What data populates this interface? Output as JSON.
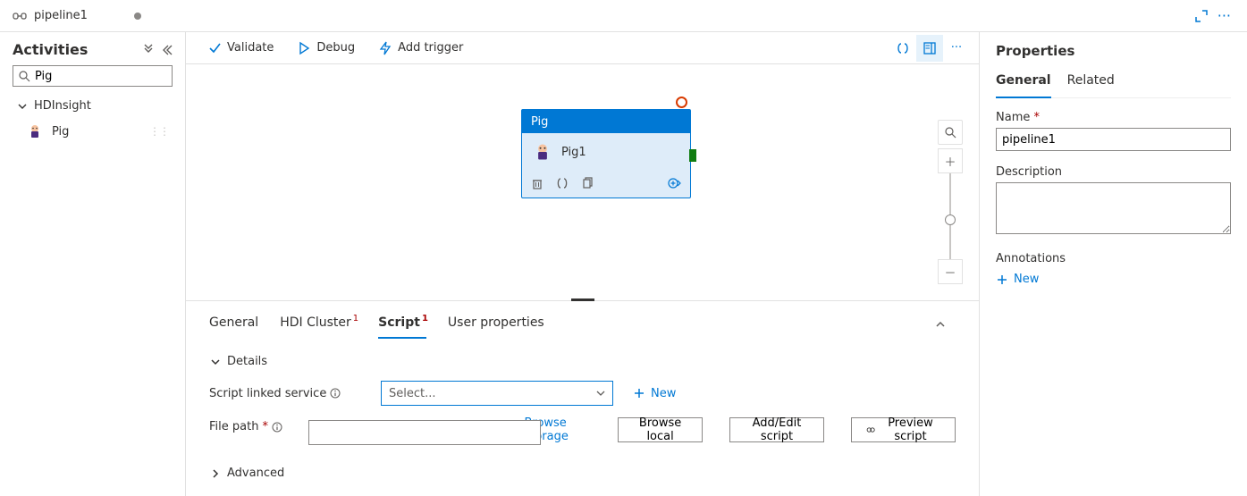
{
  "tab": {
    "title": "pipeline1"
  },
  "expand_icon": "expand",
  "sidebar": {
    "title": "Activities",
    "search_value": "Pig",
    "group_label": "HDInsight",
    "item_label": "Pig"
  },
  "toolbar": {
    "validate": "Validate",
    "debug": "Debug",
    "add_trigger": "Add trigger"
  },
  "node": {
    "type_label": "Pig",
    "name": "Pig1"
  },
  "bottom_tabs": {
    "general": "General",
    "hdi": "HDI Cluster",
    "hdi_sup": "1",
    "script": "Script",
    "script_sup": "1",
    "user_props": "User properties"
  },
  "details": {
    "header": "Details",
    "linked_label": "Script linked service",
    "select_placeholder": "Select...",
    "new_btn": "New",
    "filepath_label": "File path",
    "browse_storage": "Browse storage",
    "browse_local": "Browse local",
    "add_edit": "Add/Edit script",
    "preview": "Preview script",
    "advanced": "Advanced"
  },
  "props": {
    "title": "Properties",
    "tab_general": "General",
    "tab_related": "Related",
    "name_label": "Name",
    "name_value": "pipeline1",
    "desc_label": "Description",
    "ann_label": "Annotations",
    "ann_new": "New"
  }
}
